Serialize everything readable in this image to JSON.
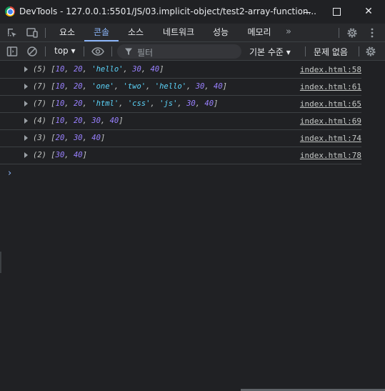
{
  "window": {
    "title": "DevTools - 127.0.0.1:5501/JS/03.implicit-object/test2-array-function..."
  },
  "tabs": [
    "요소",
    "콘솔",
    "소스",
    "네트워크",
    "성능",
    "메모리"
  ],
  "toolbar": {
    "context": "top ▾",
    "filter_placeholder": "필터",
    "levels": "기본 수준 ▾",
    "issues": "문제 없음"
  },
  "logs": [
    {
      "count": "(5)",
      "items": [
        "10",
        "20",
        "'hello'",
        "30",
        "40"
      ],
      "types": [
        "n",
        "n",
        "s",
        "n",
        "n"
      ],
      "source": "index.html:58"
    },
    {
      "count": "(7)",
      "items": [
        "10",
        "20",
        "'one'",
        "'two'",
        "'hello'",
        "30",
        "40"
      ],
      "types": [
        "n",
        "n",
        "s",
        "s",
        "s",
        "n",
        "n"
      ],
      "source": "index.html:61"
    },
    {
      "count": "(7)",
      "items": [
        "10",
        "20",
        "'html'",
        "'css'",
        "'js'",
        "30",
        "40"
      ],
      "types": [
        "n",
        "n",
        "s",
        "s",
        "s",
        "n",
        "n"
      ],
      "source": "index.html:65"
    },
    {
      "count": "(4)",
      "items": [
        "10",
        "20",
        "30",
        "40"
      ],
      "types": [
        "n",
        "n",
        "n",
        "n"
      ],
      "source": "index.html:69"
    },
    {
      "count": "(3)",
      "items": [
        "20",
        "30",
        "40"
      ],
      "types": [
        "n",
        "n",
        "n"
      ],
      "source": "index.html:74"
    },
    {
      "count": "(2)",
      "items": [
        "30",
        "40"
      ],
      "types": [
        "n",
        "n"
      ],
      "source": "index.html:78"
    }
  ],
  "prompt": "›"
}
